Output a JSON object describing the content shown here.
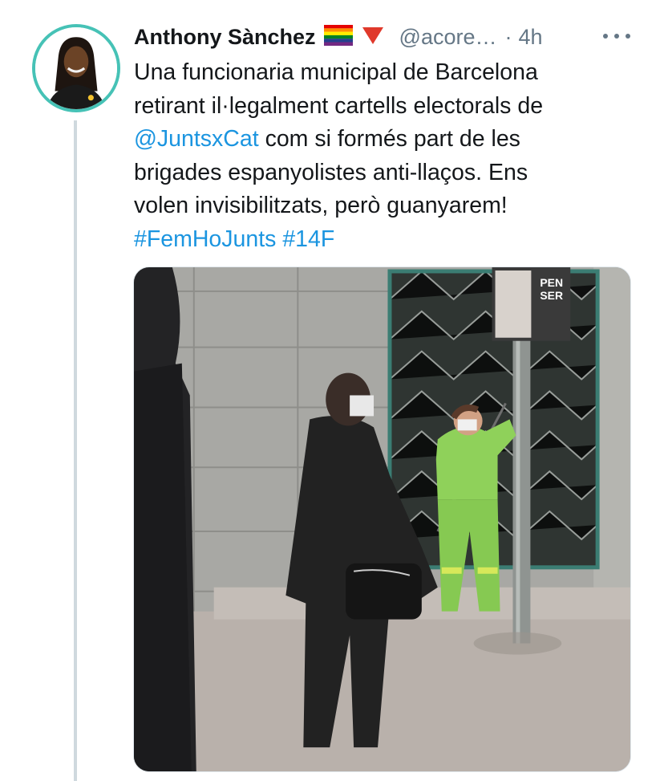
{
  "tweet": {
    "author_name": "Anthony Sànchez",
    "flag_emoji": "🏳️‍🌈",
    "badge_emoji": "🔻",
    "handle": "@acore…",
    "separator": "·",
    "time": "4h",
    "text_line1": "Una funcionaria municipal de Barcelona",
    "text_line2": "retirant il·legalment cartells electorals de",
    "mention": "@JuntsxCat",
    "text_line3_rest": " com si formés part de les",
    "text_line4": "brigades espanyolistes anti-llaços. Ens",
    "text_line5": "volen invisibilitzats, però guanyarem!",
    "hashtag1": "#FemHoJunts",
    "hashtag2": "#14F"
  },
  "media": {
    "poster_text_top": "PEN",
    "poster_text_bottom": "SER"
  },
  "icons": {
    "more": "more-horizontal-icon",
    "flag": "rainbow-flag-icon",
    "badge": "red-triangle-icon"
  },
  "colors": {
    "link": "#1b95e0",
    "secondary": "#657786",
    "avatar_ring": "#46c2b6",
    "thread_line": "#cfd9de"
  }
}
